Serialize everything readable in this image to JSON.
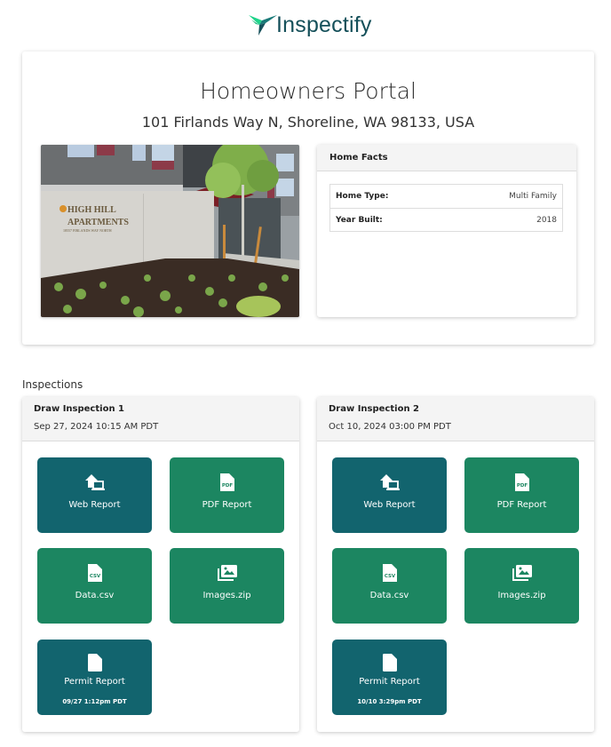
{
  "brand": {
    "name": "Inspectify",
    "logo_icon": "hummingbird-icon",
    "colors": {
      "brand_dark": "#15505a",
      "brand_green": "#1fd48a",
      "tile_teal": "#12646e",
      "tile_green": "#1c8661"
    }
  },
  "hero": {
    "title": "Homeowners Portal",
    "address": "101 Firlands Way N, Shoreline, WA 98133, USA",
    "photo": {
      "alt": "Building entrance with sign reading High Hill Apartments",
      "sign_line1": "HIGH HILL",
      "sign_line2": "APARTMENTS",
      "sign_line3": "18557 FIRLANDS WAY NORTH"
    }
  },
  "home_facts": {
    "title": "Home Facts",
    "rows": [
      {
        "label": "Home Type:",
        "value": "Multi Family"
      },
      {
        "label": "Year Built:",
        "value": "2018"
      }
    ]
  },
  "inspections_label": "Inspections",
  "inspections": [
    {
      "name": "Draw Inspection 1",
      "date": "Sep 27, 2024 10:15 AM PDT",
      "tiles": [
        {
          "label": "Web Report",
          "icon": "house-laptop-icon"
        },
        {
          "label": "PDF Report",
          "icon": "pdf-file-icon"
        },
        {
          "label": "Data.csv",
          "icon": "csv-file-icon"
        },
        {
          "label": "Images.zip",
          "icon": "images-icon"
        },
        {
          "label": "Permit Report",
          "icon": "file-icon",
          "sub": "09/27 1:12pm PDT"
        }
      ]
    },
    {
      "name": "Draw Inspection 2",
      "date": "Oct 10, 2024 03:00 PM PDT",
      "tiles": [
        {
          "label": "Web Report",
          "icon": "house-laptop-icon"
        },
        {
          "label": "PDF Report",
          "icon": "pdf-file-icon"
        },
        {
          "label": "Data.csv",
          "icon": "csv-file-icon"
        },
        {
          "label": "Images.zip",
          "icon": "images-icon"
        },
        {
          "label": "Permit Report",
          "icon": "file-icon",
          "sub": "10/10 3:29pm PDT"
        }
      ]
    }
  ]
}
